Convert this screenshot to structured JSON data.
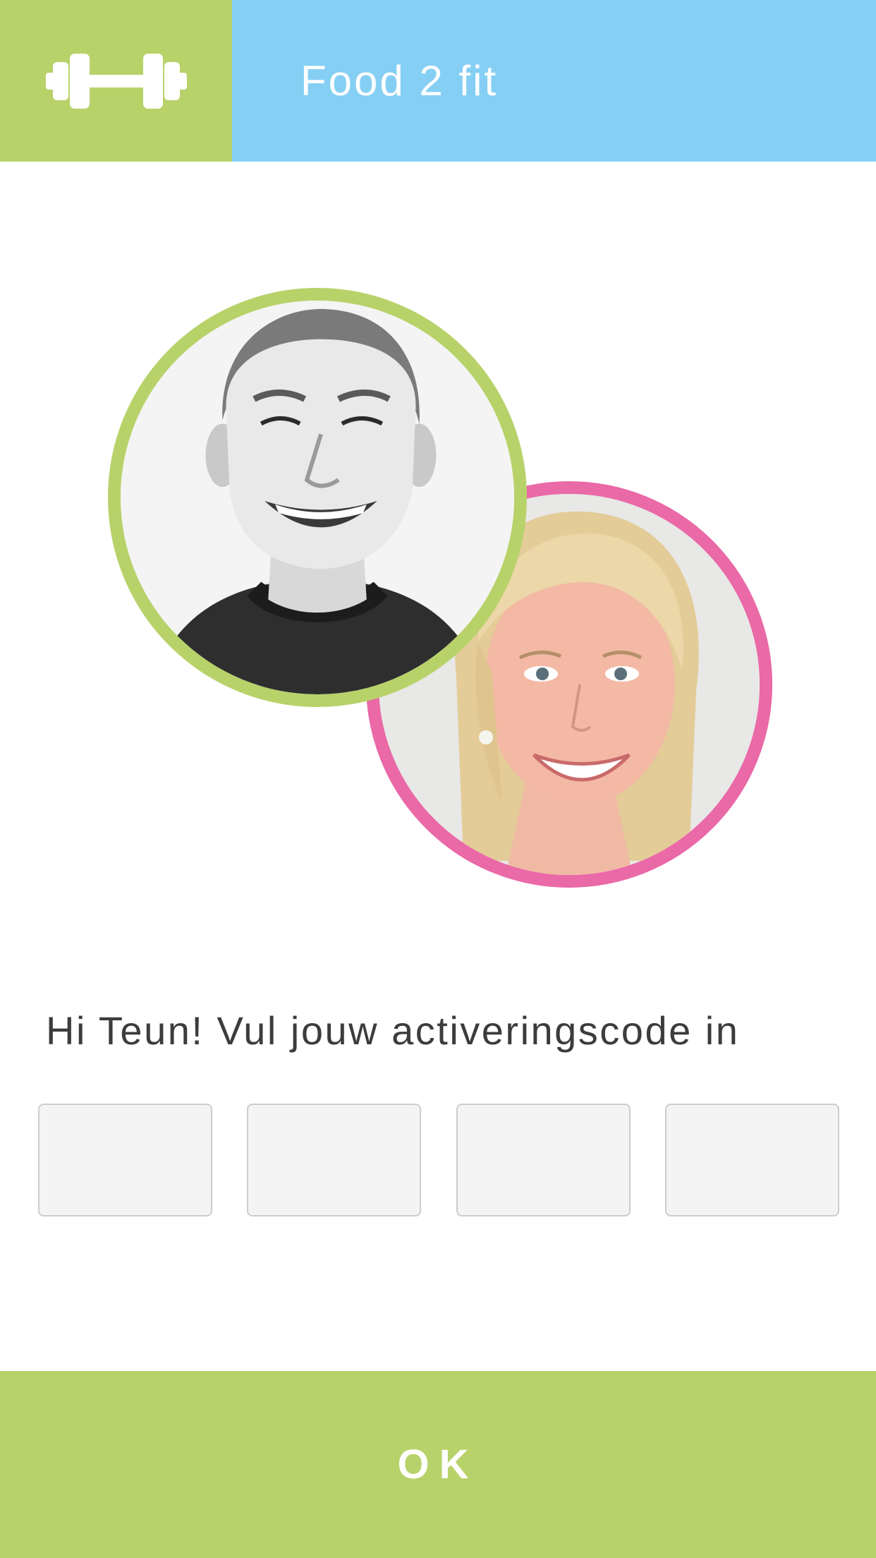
{
  "header": {
    "title": "Food 2 fit",
    "logo_icon": "dumbbell-icon",
    "logo_background": "#b8d26a",
    "title_background": "#86cff4"
  },
  "coaches": [
    {
      "ring_color": "#b8d26a",
      "photo": "male-coach-photo"
    },
    {
      "ring_color": "#ea69a7",
      "photo": "female-coach-photo"
    }
  ],
  "prompt": "Hi Teun! Vul jouw activeringscode in",
  "activation_code": {
    "fields": [
      {
        "value": "",
        "placeholder": ""
      },
      {
        "value": "",
        "placeholder": ""
      },
      {
        "value": "",
        "placeholder": ""
      },
      {
        "value": "",
        "placeholder": ""
      }
    ]
  },
  "ok_button": {
    "label": "OK",
    "background": "#b8d26a"
  }
}
